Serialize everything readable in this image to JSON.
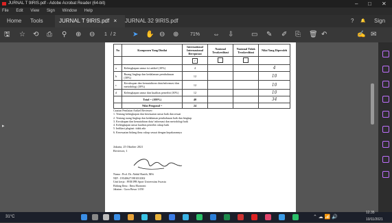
{
  "window": {
    "title": "JURNAL T 9IRIS.pdf - Adobe Acrobat Reader (64-bit)",
    "minimize": "–",
    "maximize": "□",
    "close": "✕"
  },
  "menu": [
    "File",
    "Edit",
    "View",
    "Sign",
    "Window",
    "Help"
  ],
  "tabs": {
    "home": "Home",
    "tools": "Tools",
    "doc1": "JURNAL T 9IRIS.pdf",
    "doc1_close": "×",
    "doc2": "JURNAL 32 9IRIS.pdf",
    "help": "?",
    "bell": "🔔",
    "sign_in": "Sign In"
  },
  "toolbar": {
    "page_current": "1",
    "page_total": "/ 2",
    "zoom": "71%"
  },
  "table": {
    "headers": [
      "No",
      "Komponen Yang Dinilai",
      "International Internasional Bereputasi",
      "Nasional Terakreditasi",
      "Nasional Tidak Terakreditasi",
      "Nilai Yang Diperoleh"
    ],
    "rows": [
      {
        "no": "a",
        "label": "Kelengkapan unsur isi artikel (10%)",
        "max": "4",
        "score": "4"
      },
      {
        "no": "b",
        "label": "Ruang lingkup dan kedalaman pembahasan (30%)",
        "max": "12",
        "score": "10"
      },
      {
        "no": "c",
        "label": "Kecukupan dan kemutahiran data/informasi dan metodologi (30%)",
        "max": "12",
        "score": "10"
      },
      {
        "no": "d",
        "label": "Kelengkapan unsur dan kualitas penerbit (30%)",
        "max": "12",
        "score": "10"
      }
    ],
    "total_label": "Total = (100%)",
    "total_max": "40",
    "total_score": "34",
    "pengusul_label": "Nilai Pengusul =",
    "pengusul_max": "24"
  },
  "notes": {
    "heading": "Catatan Penilaian Artikel Reviewer:",
    "items": [
      "1. Tentang kelengkapan dan kesesuaian unsur baik dan sesuai",
      "2. Tentang ruang lingkup dan kedalaman pembahasan baik dan lengkap",
      "3. Kecukupan dan kemutahiran data/ informasi dan metodologi baik",
      "4. Kelengkapan unsur kualitas penerbit cukup baik",
      "5. Indikasi plagiasi: tidak ada",
      "6. Kesesuaian bidang ilmu cukup sesuai dengan kepakarannya"
    ]
  },
  "signature": {
    "place_date": "Jakarta, 25 Oktober 2021",
    "role": "Reviewer, 1",
    "name": "Nama : Prof. Dr. Abdul Basith, MSi",
    "nip": "NIP : 195406271981031002",
    "unit": "Unit kerja : FEB IPB Sport Universitas Swasta",
    "field": "Bidang Ilmu : Ilmu Ekonomi",
    "rank": "Jabatan : Guru Besar 1.050"
  },
  "taskbar": {
    "weather": "31°C",
    "time": "12.35",
    "date": "10/11/2021"
  },
  "colors": {
    "accent": "#c070ff",
    "titlebar": "#1f1f1f",
    "doc_bg": "#555555"
  }
}
